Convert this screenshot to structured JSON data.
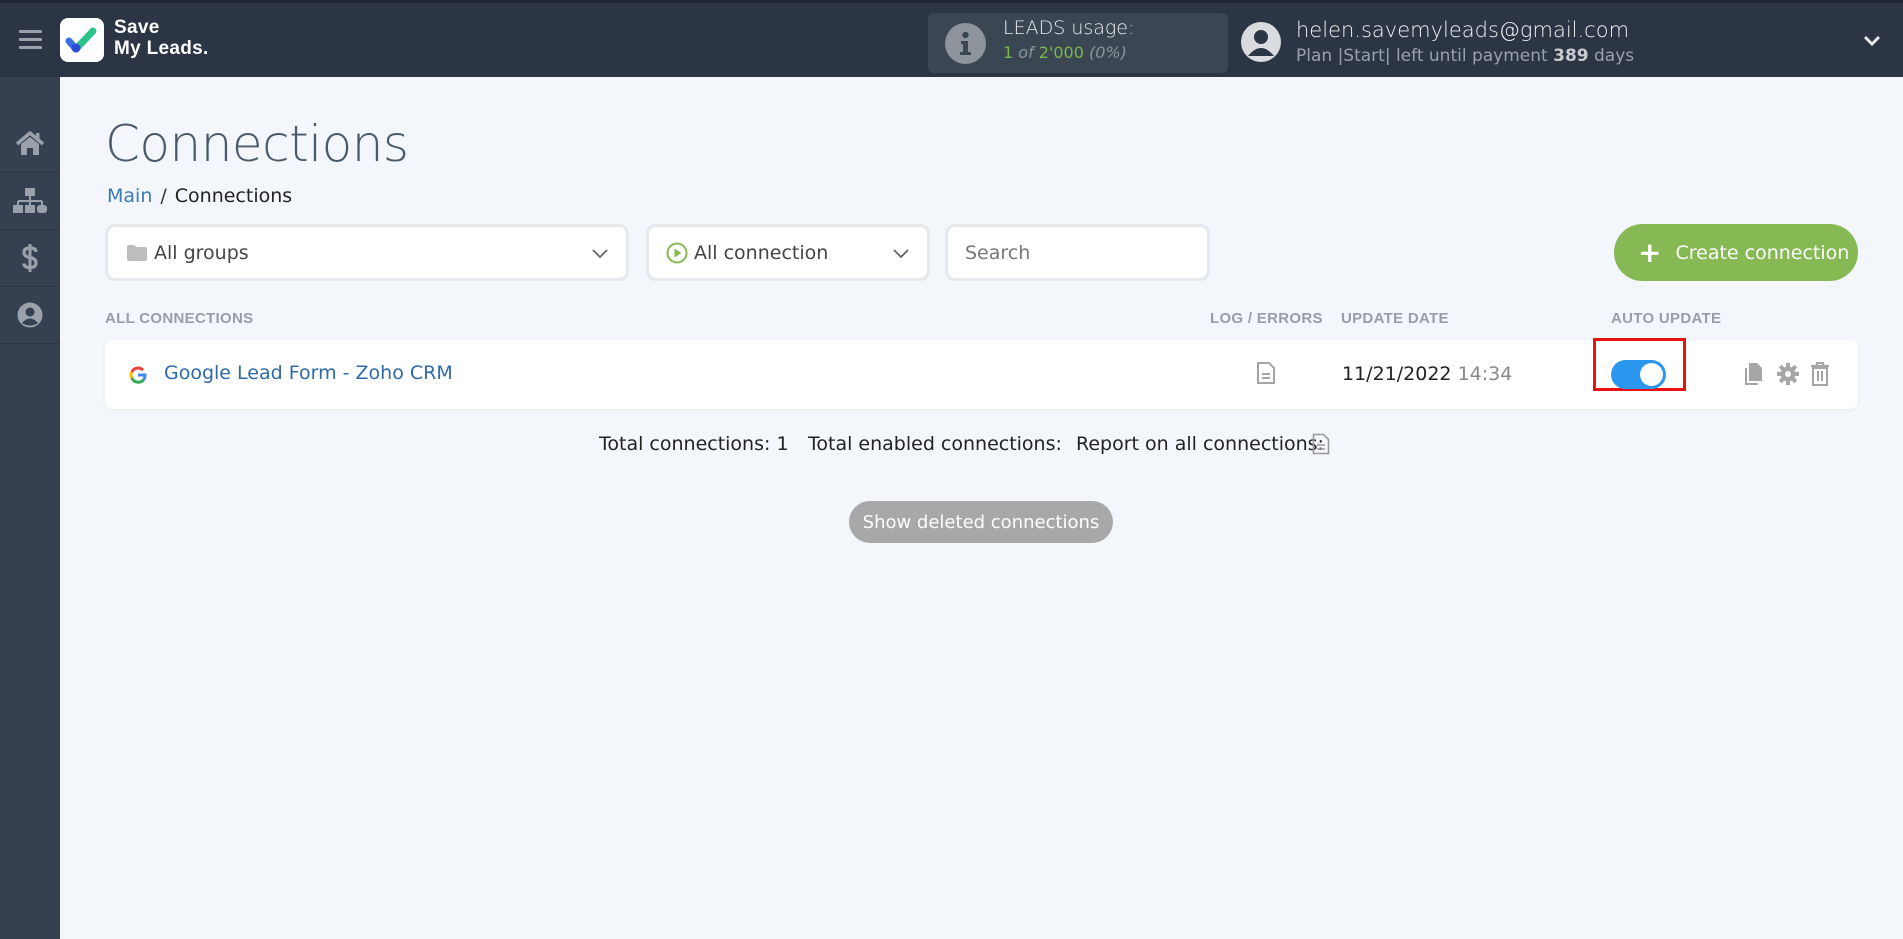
{
  "app": {
    "logo_line1": "Save",
    "logo_line2": "My Leads."
  },
  "header": {
    "leads_usage": {
      "title": "LEADS usage:",
      "used": "1",
      "of_label": "of",
      "total": "2'000",
      "percent": "(0%)"
    },
    "user": {
      "email": "helen.savemyleads@gmail.com",
      "plan_prefix": "Plan |Start| left until payment",
      "days": "389",
      "days_suffix": "days"
    }
  },
  "sidebar": {
    "items": [
      {
        "name": "home",
        "icon": "home-icon"
      },
      {
        "name": "connections",
        "icon": "sitemap-icon"
      },
      {
        "name": "billing",
        "icon": "dollar-icon"
      },
      {
        "name": "account",
        "icon": "user-circle-icon"
      }
    ]
  },
  "page": {
    "title": "Connections",
    "breadcrumb": {
      "main": "Main",
      "separator": "/",
      "current": "Connections"
    }
  },
  "filters": {
    "groups_selected": "All groups",
    "connection_selected": "All connection",
    "search_placeholder": "Search",
    "create_label": "Create connection",
    "create_color": "#86b953"
  },
  "table": {
    "headers": {
      "all_connections": "ALL CONNECTIONS",
      "log_errors": "LOG / ERRORS",
      "update_date": "UPDATE DATE",
      "auto_update": "AUTO UPDATE"
    },
    "rows": [
      {
        "name": "Google Lead Form - Zoho CRM",
        "source_icon": "google-icon",
        "date": "11/21/2022",
        "time": "14:34",
        "auto_update": true,
        "toggle_color": "#2b96ee"
      }
    ]
  },
  "summary": {
    "total_connections": "Total connections: 1",
    "total_enabled": "Total enabled connections:",
    "report_label": "Report on all connections:"
  },
  "show_deleted_label": "Show deleted connections"
}
